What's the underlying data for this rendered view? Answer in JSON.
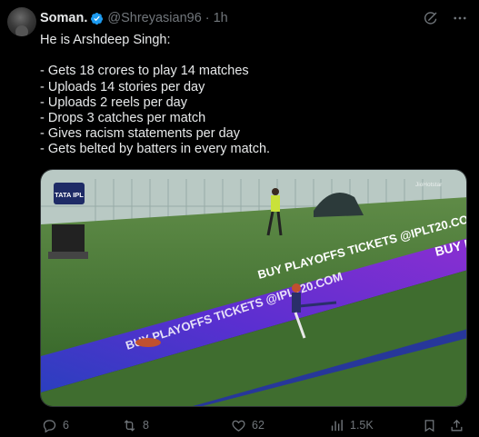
{
  "tweet": {
    "author": {
      "display_name": "Soman.",
      "handle": "@Shreyasian96",
      "separator": "·",
      "time": "1h",
      "verified": true
    },
    "text": "He is Arshdeep Singh:\n\n- Gets 18 crores to play 14 matches\n- Uploads 14 stories per day\n- Uploads 2 reels per day\n- Drops 3 catches per match\n- Gives racism statements per day\n- Gets belted by batters in every match.",
    "media": {
      "type": "video-still",
      "overlay_logo": "TATA IPL",
      "broadcaster_watermark": "JioHotstar",
      "boards_text": "BUY PLAYOFFS TICKETS @IPLT20.COM",
      "boards_text_short": "BUY P",
      "colors": {
        "pitch": "#3f6d2f",
        "boards_blue": "#2b3fbf",
        "boards_purple": "#8a2fd1",
        "sky": "#c9d7d2"
      }
    },
    "actions": {
      "replies": "6",
      "reposts": "8",
      "likes": "62",
      "views": "1.5K"
    },
    "icons": {
      "verified": "verified-badge-icon",
      "grok": "grok-icon",
      "more": "more-icon",
      "reply": "reply-icon",
      "repost": "repost-icon",
      "like": "like-icon",
      "views": "views-icon",
      "bookmark": "bookmark-icon",
      "share": "share-icon"
    },
    "accent_color": "#1d9bf0",
    "muted_color": "#71767b"
  }
}
